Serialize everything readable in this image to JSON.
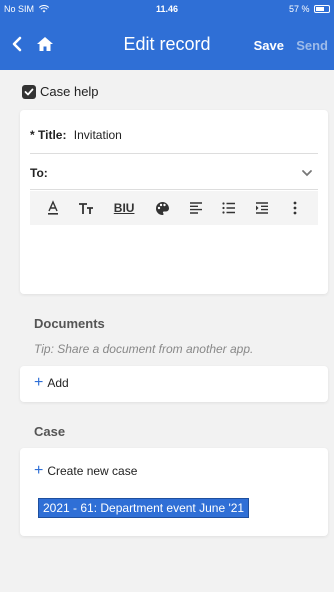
{
  "status": {
    "carrier": "No SIM",
    "time": "11.46",
    "battery": "57 %"
  },
  "nav": {
    "title": "Edit record",
    "save_label": "Save",
    "send_label": "Send"
  },
  "case_help": {
    "label": "Case help",
    "checked": true
  },
  "form": {
    "title_label": "* Title:",
    "title_value": "Invitation",
    "to_label": "To:"
  },
  "toolbar": {
    "icons": [
      "text-color-icon",
      "text-size-icon",
      "bold-italic-underline-icon",
      "palette-icon",
      "align-left-icon",
      "bullet-list-icon",
      "indent-icon",
      "more-vertical-icon"
    ],
    "biu": "BIU"
  },
  "documents": {
    "heading": "Documents",
    "tip": "Tip: Share a document from another app.",
    "add_label": "Add"
  },
  "case": {
    "heading": "Case",
    "create_label": "Create new case",
    "selected_case": "2021 - 61: Department event June '21"
  },
  "colors": {
    "accent": "#2f6fd6",
    "background": "#f2f2f2"
  }
}
